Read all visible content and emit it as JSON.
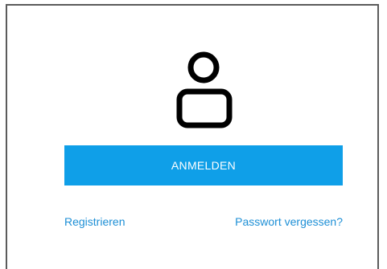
{
  "login_panel": {
    "icon": "user-icon",
    "login_button_label": "ANMELDEN",
    "register_link": "Registrieren",
    "forgot_password_link": "Passwort vergessen?"
  },
  "colors": {
    "button_background": "#0f9fe8",
    "button_text": "#ffffff",
    "link": "#1d8fd6",
    "panel_border": "#5b5b5b",
    "icon_stroke": "#000000"
  }
}
